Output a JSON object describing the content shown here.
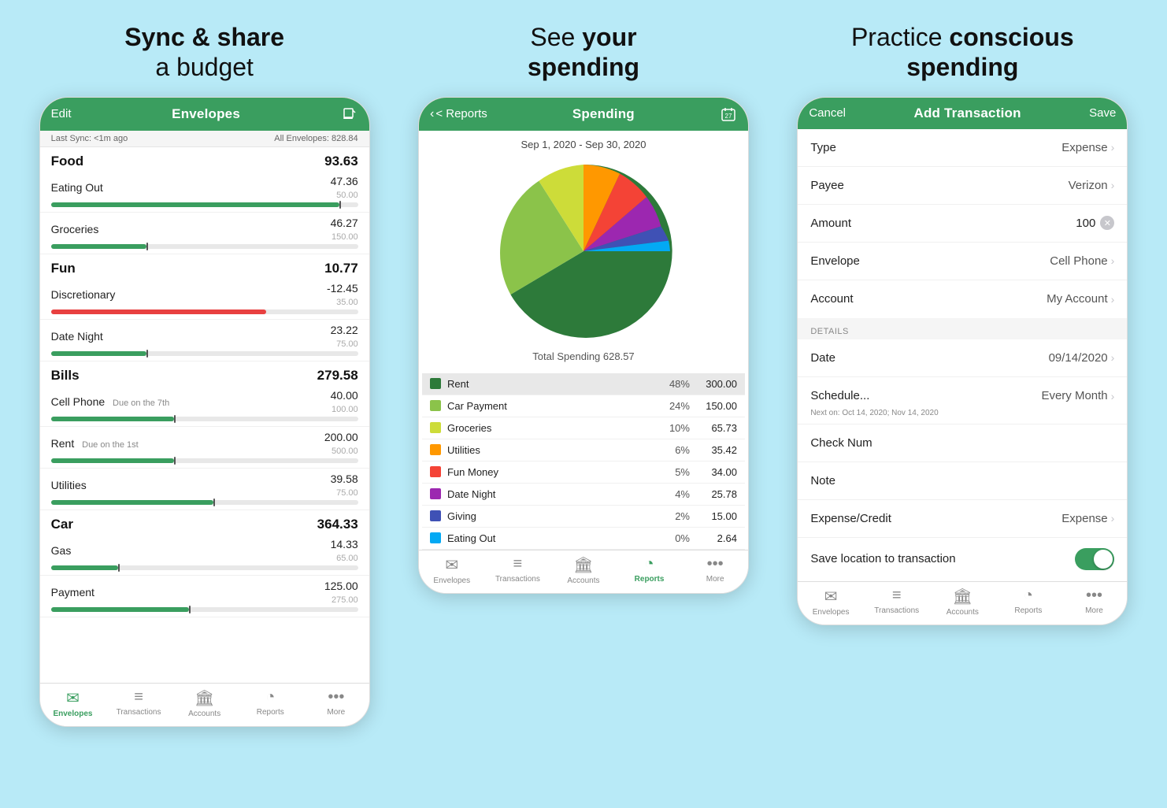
{
  "background": "#b8eaf7",
  "panels": [
    {
      "id": "panel1",
      "title_plain": "Sync & share",
      "title_bold": "a budget",
      "title_format": "bold_then_plain",
      "phone": {
        "nav": {
          "left": "Edit",
          "center": "Envelopes",
          "right_icon": "edit-icon"
        },
        "sync_bar": {
          "left": "Last Sync: <1m ago",
          "right": "All Envelopes: 828.84"
        },
        "groups": [
          {
            "name": "Food",
            "total": "93.63",
            "items": [
              {
                "name": "Eating Out",
                "amount": "47.36",
                "budget": "50.00",
                "fill_pct": 94,
                "red": false,
                "marker_pct": 94,
                "due": ""
              },
              {
                "name": "Groceries",
                "amount": "46.27",
                "budget": "150.00",
                "fill_pct": 31,
                "red": false,
                "marker_pct": 31,
                "due": ""
              }
            ]
          },
          {
            "name": "Fun",
            "total": "10.77",
            "items": [
              {
                "name": "Discretionary",
                "amount": "-12.45",
                "budget": "35.00",
                "fill_pct": 80,
                "red": true,
                "marker_pct": 80,
                "due": ""
              },
              {
                "name": "Date Night",
                "amount": "23.22",
                "budget": "75.00",
                "fill_pct": 31,
                "red": false,
                "marker_pct": 31,
                "due": ""
              }
            ]
          },
          {
            "name": "Bills",
            "total": "279.58",
            "items": [
              {
                "name": "Cell Phone",
                "amount": "40.00",
                "budget": "100.00",
                "fill_pct": 40,
                "red": false,
                "marker_pct": 40,
                "due": "Due on the 7th"
              },
              {
                "name": "Rent",
                "amount": "200.00",
                "budget": "500.00",
                "fill_pct": 40,
                "red": false,
                "marker_pct": 40,
                "due": "Due on the 1st"
              },
              {
                "name": "Utilities",
                "amount": "39.58",
                "budget": "75.00",
                "fill_pct": 53,
                "red": false,
                "marker_pct": 53,
                "due": ""
              }
            ]
          },
          {
            "name": "Car",
            "total": "364.33",
            "items": [
              {
                "name": "Gas",
                "amount": "14.33",
                "budget": "65.00",
                "fill_pct": 22,
                "red": false,
                "marker_pct": 22,
                "due": ""
              },
              {
                "name": "Payment",
                "amount": "125.00",
                "budget": "275.00",
                "fill_pct": 45,
                "red": false,
                "marker_pct": 45,
                "due": ""
              }
            ]
          }
        ],
        "tabs": [
          {
            "icon": "envelope-icon",
            "label": "Envelopes",
            "active": true
          },
          {
            "icon": "transactions-icon",
            "label": "Transactions",
            "active": false
          },
          {
            "icon": "accounts-icon",
            "label": "Accounts",
            "active": false
          },
          {
            "icon": "reports-icon",
            "label": "Reports",
            "active": false
          },
          {
            "icon": "more-icon",
            "label": "More",
            "active": false
          }
        ]
      }
    },
    {
      "id": "panel2",
      "title_plain": "See your spending",
      "phone": {
        "nav": {
          "left": "< Reports",
          "center": "Spending",
          "right_icon": "calendar-icon"
        },
        "date_range": "Sep 1, 2020 - Sep 30, 2020",
        "total_spending": "Total Spending 628.57",
        "pie_data": [
          {
            "label": "Rent",
            "pct": 48,
            "amount": "300.00",
            "color": "#2d7a3a",
            "start": 0,
            "sweep": 172.8
          },
          {
            "label": "Car Payment",
            "pct": 24,
            "amount": "150.00",
            "color": "#8bc34a",
            "start": 172.8,
            "sweep": 86.4
          },
          {
            "label": "Groceries",
            "pct": 10,
            "amount": "65.73",
            "color": "#cddc39",
            "start": 259.2,
            "sweep": 36
          },
          {
            "label": "Utilities",
            "pct": 6,
            "amount": "35.42",
            "color": "#ff9800",
            "start": 295.2,
            "sweep": 21.6
          },
          {
            "label": "Fun Money",
            "pct": 5,
            "amount": "34.00",
            "color": "#f44336",
            "start": 316.8,
            "sweep": 18
          },
          {
            "label": "Date Night",
            "pct": 4,
            "amount": "25.78",
            "color": "#9c27b0",
            "start": 334.8,
            "sweep": 14.4
          },
          {
            "label": "Giving",
            "pct": 2,
            "amount": "15.00",
            "color": "#3f51b5",
            "start": 349.2,
            "sweep": 7.2
          },
          {
            "label": "Eating Out",
            "pct": 0,
            "amount": "2.64",
            "color": "#03a9f4",
            "start": 356.4,
            "sweep": 3.6
          }
        ],
        "tabs": [
          {
            "icon": "envelope-icon",
            "label": "Envelopes",
            "active": false
          },
          {
            "icon": "transactions-icon",
            "label": "Transactions",
            "active": false
          },
          {
            "icon": "accounts-icon",
            "label": "Accounts",
            "active": false
          },
          {
            "icon": "reports-icon",
            "label": "Reports",
            "active": true
          },
          {
            "icon": "more-icon",
            "label": "More",
            "active": false
          }
        ]
      }
    },
    {
      "id": "panel3",
      "title_plain": "Practice ",
      "title_bold": "conscious spending",
      "phone": {
        "nav": {
          "left": "Cancel",
          "center": "Add Transaction",
          "right": "Save"
        },
        "form_rows": [
          {
            "section": null,
            "label": "Type",
            "value": "Expense",
            "has_chevron": true
          },
          {
            "section": null,
            "label": "Payee",
            "value": "Verizon",
            "has_chevron": true
          },
          {
            "section": null,
            "label": "Amount",
            "value": "100",
            "has_clear": true,
            "has_chevron": false
          },
          {
            "section": null,
            "label": "Envelope",
            "value": "Cell Phone",
            "has_chevron": true
          },
          {
            "section": null,
            "label": "Account",
            "value": "My Account",
            "has_chevron": true
          }
        ],
        "details_label": "DETAILS",
        "detail_rows": [
          {
            "label": "Date",
            "value": "09/14/2020",
            "has_chevron": true
          },
          {
            "label": "Schedule...",
            "value": "Every Month",
            "has_chevron": true,
            "sub": "Next on: Oct 14, 2020; Nov 14, 2020"
          },
          {
            "label": "Check Num",
            "value": "",
            "has_chevron": false
          },
          {
            "label": "Note",
            "value": "",
            "has_chevron": false
          },
          {
            "label": "Expense/Credit",
            "value": "Expense",
            "has_chevron": true
          },
          {
            "label": "Save location to transaction",
            "value": "toggle_on",
            "has_chevron": false
          }
        ],
        "tabs": [
          {
            "icon": "envelope-icon",
            "label": "Envelopes",
            "active": false
          },
          {
            "icon": "transactions-icon",
            "label": "Transactions",
            "active": false
          },
          {
            "icon": "accounts-icon",
            "label": "Accounts",
            "active": false
          },
          {
            "icon": "reports-icon",
            "label": "Reports",
            "active": false
          },
          {
            "icon": "more-icon",
            "label": "More",
            "active": false
          }
        ]
      }
    }
  ]
}
